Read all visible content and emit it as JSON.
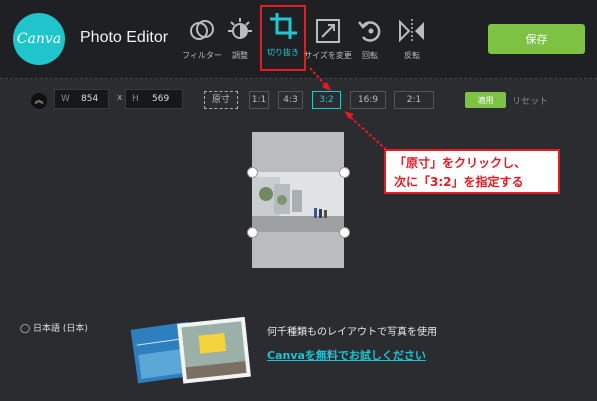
{
  "header": {
    "logo_text": "Canva",
    "app_title": "Photo Editor",
    "tools": [
      {
        "label": "フィルター",
        "icon": "filter-icon"
      },
      {
        "label": "調整",
        "icon": "adjust-icon"
      },
      {
        "label": "切り抜き",
        "icon": "crop-icon",
        "active": true
      },
      {
        "label": "サイズを変更",
        "icon": "resize-icon"
      },
      {
        "label": "回転",
        "icon": "rotate-icon"
      },
      {
        "label": "反転",
        "icon": "flip-icon"
      }
    ],
    "save_label": "保存"
  },
  "crop_bar": {
    "width_label": "W",
    "width_value": "854",
    "times": "x",
    "height_label": "H",
    "height_value": "569",
    "ratios": [
      "原寸",
      "1:1",
      "4:3",
      "3:2",
      "16:9",
      "2:1"
    ],
    "selected_ratio": "3:2",
    "apply_label": "適用",
    "reset_label": "リセット"
  },
  "annotation": {
    "line1": "「原寸」をクリックし、",
    "line2": "次に「3:2」を指定する"
  },
  "footer": {
    "language": "日本語 (日本)",
    "promo_text": "何千種類ものレイアウトで写真を使用",
    "promo_link": "Canvaを無料でお試しください"
  },
  "colors": {
    "accent": "#25c6d0",
    "save_green": "#7dc242",
    "annotation_red": "#e31b23",
    "background": "#2a2c30"
  }
}
